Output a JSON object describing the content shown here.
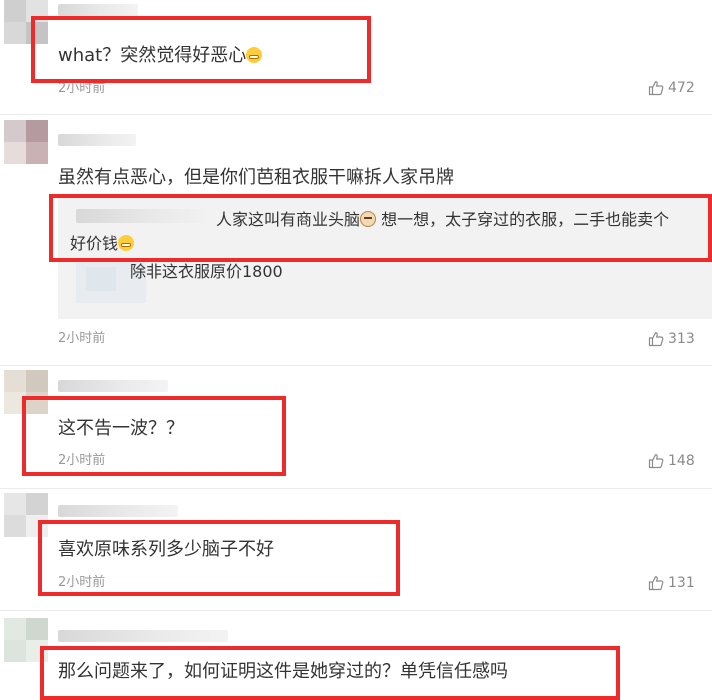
{
  "comments": [
    {
      "text": "what？突然觉得好恶心",
      "emoji": "grimace-emoji",
      "time": "2小时前",
      "likes": "472"
    },
    {
      "text": "虽然有点恶心，但是你们芭租衣服干嘛拆人家吊牌",
      "time": "2小时前",
      "likes": "313",
      "replies": [
        {
          "text_part1": "人家这叫有商业头脑",
          "emoji1": "dog-emoji",
          "text_part2": " 想一想，太子穿过的衣服，二手也能卖个",
          "text_line2": "好价钱",
          "emoji2": "grimace-emoji"
        },
        {
          "text": "除非这衣服原价1800"
        }
      ]
    },
    {
      "text": "这不告一波？？",
      "time": "2小时前",
      "likes": "148"
    },
    {
      "text": "喜欢原味系列多少脑子不好",
      "time": "2小时前",
      "likes": "131"
    },
    {
      "text": "那么问题来了，如何证明这件是她穿过的？单凭信任感吗"
    }
  ],
  "icons": {
    "like": "thumbs-up-icon"
  },
  "colors": {
    "highlight_box": "#ee2b2b",
    "time_text": "#9a9a9a",
    "reply_bg": "#f2f2f2"
  }
}
